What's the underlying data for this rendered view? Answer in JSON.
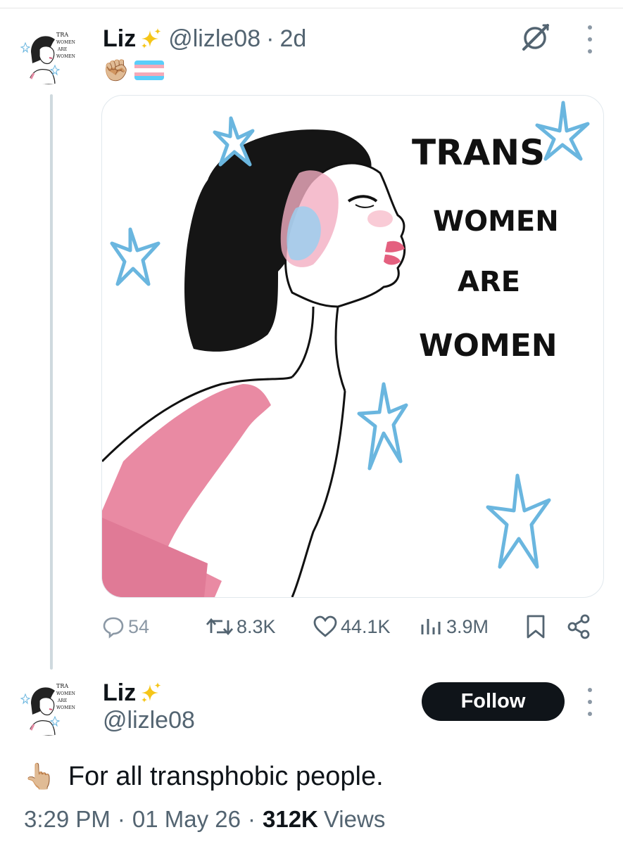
{
  "reply_tweet": {
    "display_name": "Liz",
    "handle": "@lizle08",
    "separator": "·",
    "time_ago": "2d",
    "emojis": [
      "✊🏼",
      "🏳️‍⚧️"
    ],
    "image_text": [
      "TRANS",
      "WOMEN",
      "ARE",
      "WOMEN"
    ],
    "actions": {
      "replies": "54",
      "reposts": "8.3K",
      "likes": "44.1K",
      "views": "3.9M"
    }
  },
  "main_tweet": {
    "display_name": "Liz",
    "handle": "@lizle08",
    "follow_label": "Follow",
    "pointer_emoji": "👆🏼",
    "text": "For all transphobic people.",
    "time": "3:29 PM",
    "dot": "·",
    "date": "01 May 26",
    "views_count": "312K",
    "views_label": "Views"
  },
  "colors": {
    "text": "#0f1419",
    "muted": "#536471",
    "thread_line": "#cfd9de",
    "star_blue": "#6ab6df",
    "pink": "#e58aa3",
    "follow_bg": "#0f1419"
  }
}
